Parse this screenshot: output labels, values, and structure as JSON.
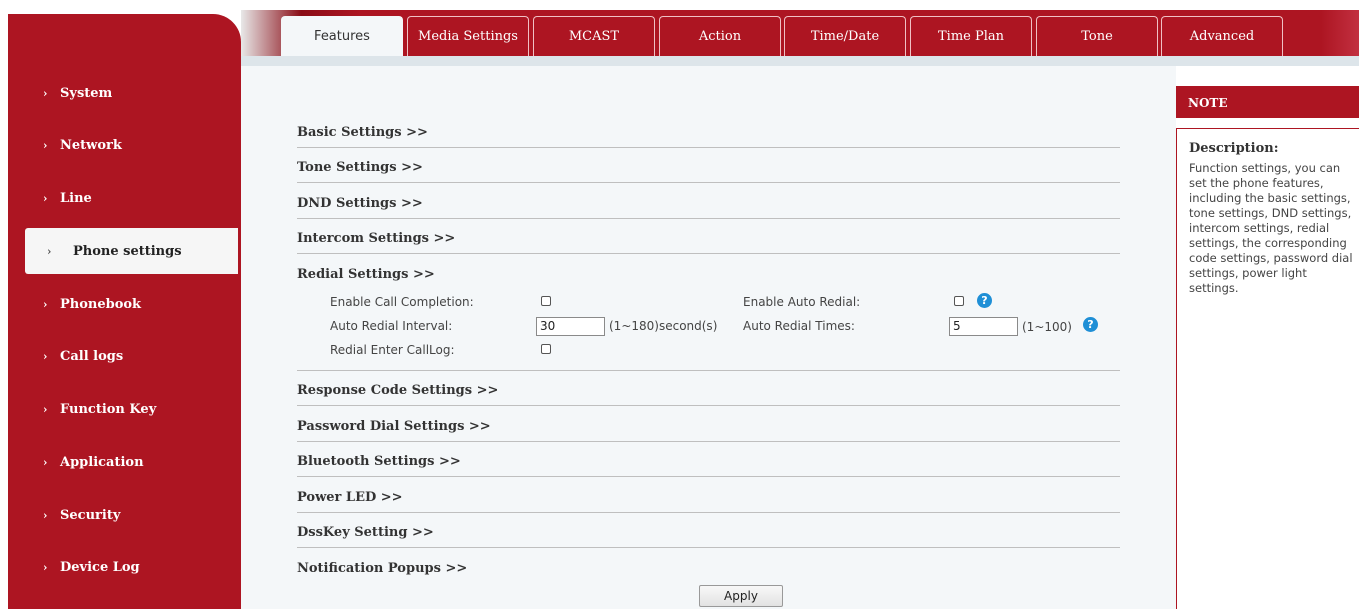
{
  "sidebar": {
    "items": [
      {
        "label": "System",
        "active": false
      },
      {
        "label": "Network",
        "active": false
      },
      {
        "label": "Line",
        "active": false
      },
      {
        "label": "Phone settings",
        "active": true
      },
      {
        "label": "Phonebook",
        "active": false
      },
      {
        "label": "Call logs",
        "active": false
      },
      {
        "label": "Function Key",
        "active": false
      },
      {
        "label": "Application",
        "active": false
      },
      {
        "label": "Security",
        "active": false
      },
      {
        "label": "Device Log",
        "active": false
      }
    ],
    "chevron": "›"
  },
  "tabs": [
    {
      "label": "Features",
      "active": true
    },
    {
      "label": "Media Settings",
      "active": false
    },
    {
      "label": "MCAST",
      "active": false
    },
    {
      "label": "Action",
      "active": false
    },
    {
      "label": "Time/Date",
      "active": false
    },
    {
      "label": "Time Plan",
      "active": false
    },
    {
      "label": "Tone",
      "active": false
    },
    {
      "label": "Advanced",
      "active": false
    }
  ],
  "sections": {
    "basic": "Basic Settings >>",
    "tone": "Tone Settings >>",
    "dnd": "DND Settings >>",
    "intercom": "Intercom Settings >>",
    "redial": "Redial Settings >>",
    "response_code": "Response Code Settings >>",
    "password_dial": "Password Dial Settings >>",
    "bluetooth": "Bluetooth Settings >>",
    "power_led": "Power LED >>",
    "dsskey": "DssKey Setting >>",
    "notification": "Notification Popups >>"
  },
  "redial": {
    "enable_call_completion_label": "Enable Call Completion:",
    "enable_call_completion_checked": false,
    "enable_auto_redial_label": "Enable Auto Redial:",
    "enable_auto_redial_checked": false,
    "auto_redial_interval_label": "Auto Redial Interval:",
    "auto_redial_interval_value": "30",
    "auto_redial_interval_range": "(1~180)second(s)",
    "auto_redial_times_label": "Auto Redial Times:",
    "auto_redial_times_value": "5",
    "auto_redial_times_range": "(1~100)",
    "redial_enter_calllog_label": "Redial Enter CallLog:",
    "redial_enter_calllog_checked": false,
    "help_glyph": "?"
  },
  "apply_label": "Apply",
  "note": {
    "header": "NOTE",
    "title": "Description:",
    "text": "Function settings, you can set the phone features, including the basic settings, tone settings, DND settings, intercom settings, redial settings, the corresponding code settings, password dial settings, power light settings."
  },
  "colors": {
    "brand": "#ad1522",
    "content_bg": "#f4f7f9",
    "help_icon": "#1f8fd6"
  }
}
